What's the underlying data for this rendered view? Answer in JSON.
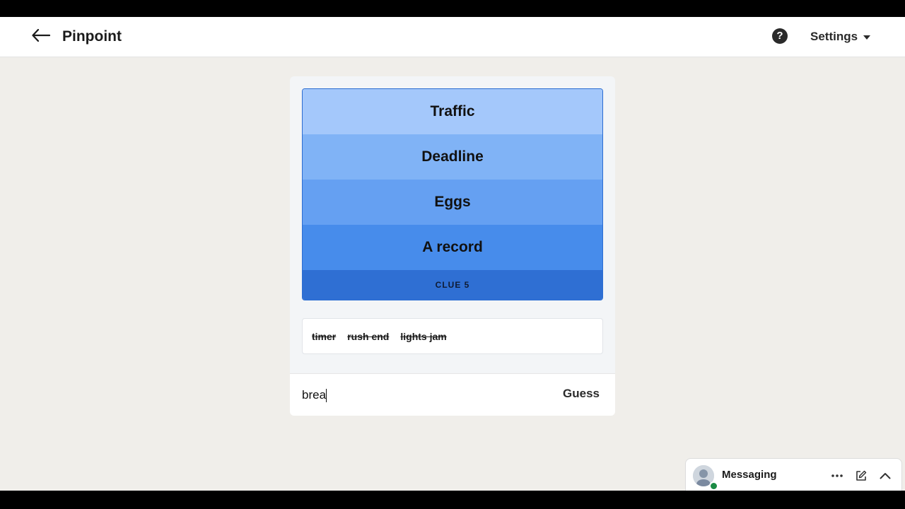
{
  "header": {
    "title": "Pinpoint",
    "help_icon": "question-circle-icon",
    "settings_label": "Settings"
  },
  "clues": [
    {
      "label": "Traffic"
    },
    {
      "label": "Deadline"
    },
    {
      "label": "Eggs"
    },
    {
      "label": "A record"
    },
    {
      "label": "CLUE 5"
    }
  ],
  "previous_guesses": [
    "timer",
    "rush end",
    "lights jam"
  ],
  "guess_input": {
    "value": "brea",
    "button_label": "Guess"
  },
  "messaging": {
    "label": "Messaging",
    "presence_color": "#1a8a44"
  },
  "colors": {
    "clue_1": "#a4c8fb",
    "clue_2": "#80b3f6",
    "clue_3": "#65a0f2",
    "clue_4": "#478ceb",
    "clue_5": "#2f6fd3",
    "page_background": "#f0eeea"
  }
}
